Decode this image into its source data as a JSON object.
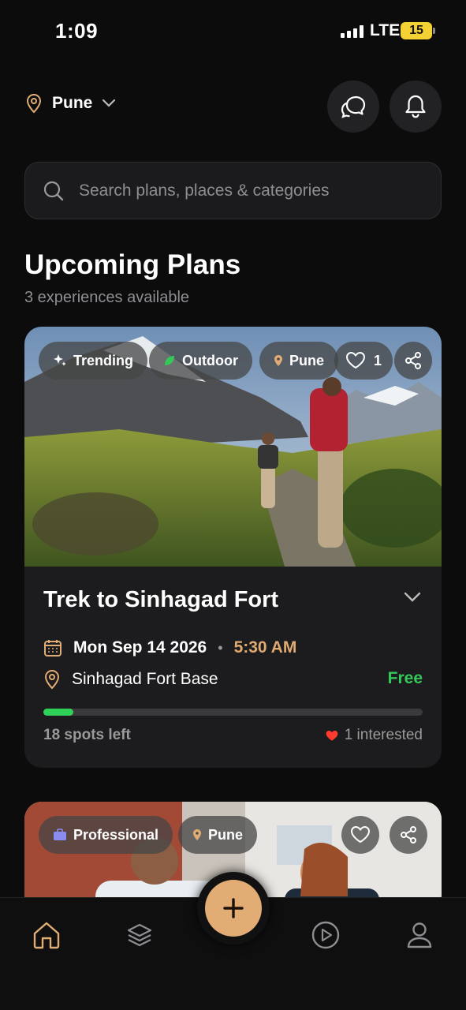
{
  "status_bar": {
    "time": "1:09",
    "network": "LTE",
    "battery": "15"
  },
  "header": {
    "location": "Pune"
  },
  "search": {
    "placeholder": "Search plans, places & categories"
  },
  "section": {
    "title": "Upcoming Plans",
    "subtitle": "3 experiences available"
  },
  "cards": [
    {
      "tags": [
        "Trending",
        "Outdoor",
        "Pune"
      ],
      "likes": "1",
      "title": "Trek to Sinhagad Fort",
      "date": "Mon Sep 14 2026",
      "time": "5:30 AM",
      "venue": "Sinhagad Fort Base",
      "price": "Free",
      "spots_left": "18 spots left",
      "spots_fill_fraction": 0.08,
      "interested": "1 interested"
    },
    {
      "tags": [
        "Professional",
        "Pune"
      ]
    }
  ],
  "colors": {
    "accent": "#e2ad74",
    "free": "#34c759",
    "progress": "#30d158",
    "heart": "#ff3b30"
  }
}
